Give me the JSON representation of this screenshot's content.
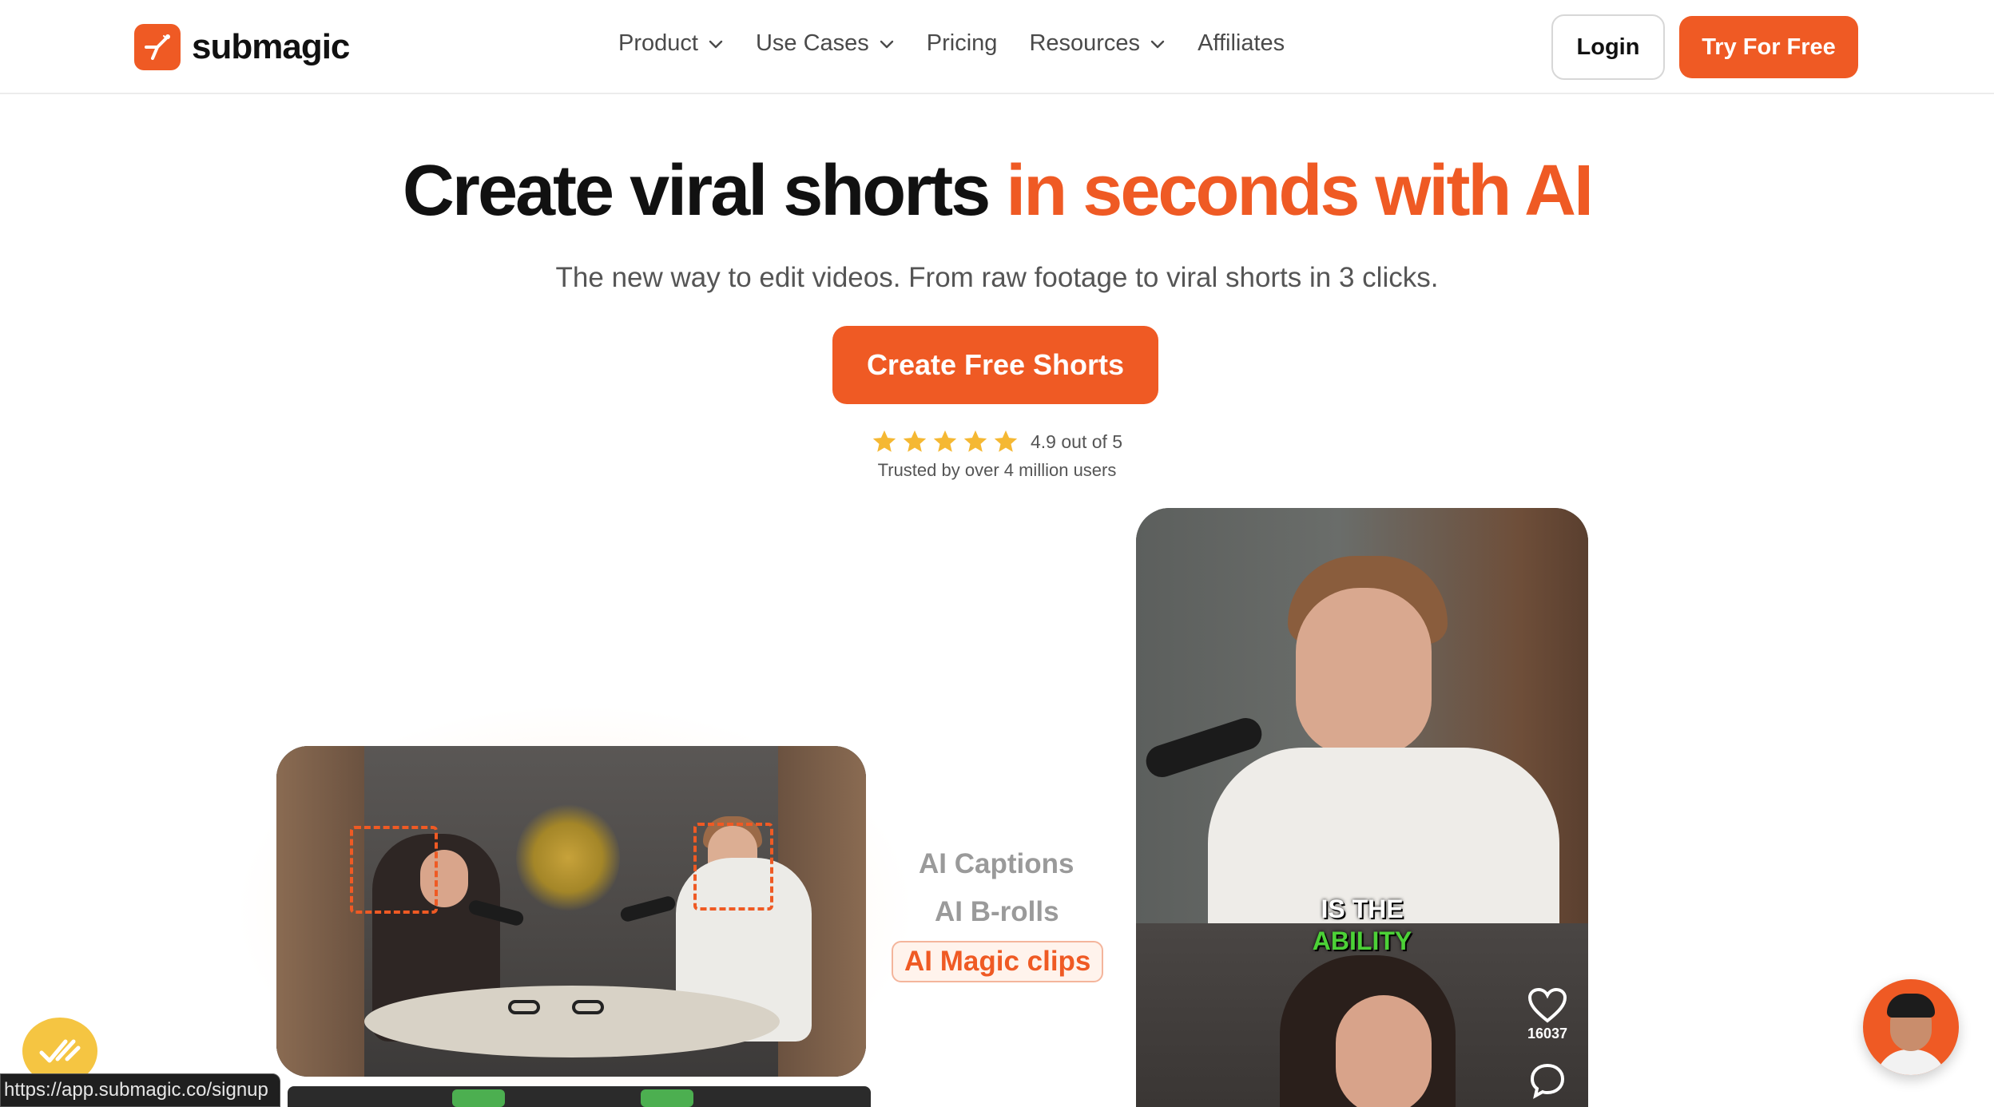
{
  "nav": {
    "brand": "submagic",
    "items": [
      {
        "label": "Product",
        "has_dropdown": true
      },
      {
        "label": "Use Cases",
        "has_dropdown": true
      },
      {
        "label": "Pricing",
        "has_dropdown": false
      },
      {
        "label": "Resources",
        "has_dropdown": true
      },
      {
        "label": "Affiliates",
        "has_dropdown": false
      }
    ],
    "login_label": "Login",
    "try_label": "Try For Free"
  },
  "hero": {
    "title_main": "Create viral shorts",
    "title_accent": "in seconds with AI",
    "subtitle": "The new way to edit videos. From raw footage to viral shorts in 3 clicks.",
    "cta_label": "Create Free Shorts",
    "rating_text": "4.9 out of 5",
    "stars": 5,
    "trusted_text": "Trusted by over 4 million users"
  },
  "features": {
    "items": [
      "AI Captions",
      "AI B-rolls"
    ],
    "active": "AI Magic clips"
  },
  "phone_video": {
    "caption_line1": "IS THE",
    "caption_line2": "ABILITY",
    "like_count": "16037"
  },
  "status_url": "https://app.submagic.co/signup",
  "colors": {
    "accent": "#ef5a24",
    "star": "#f5b833",
    "caption_highlight": "#4cd137"
  }
}
